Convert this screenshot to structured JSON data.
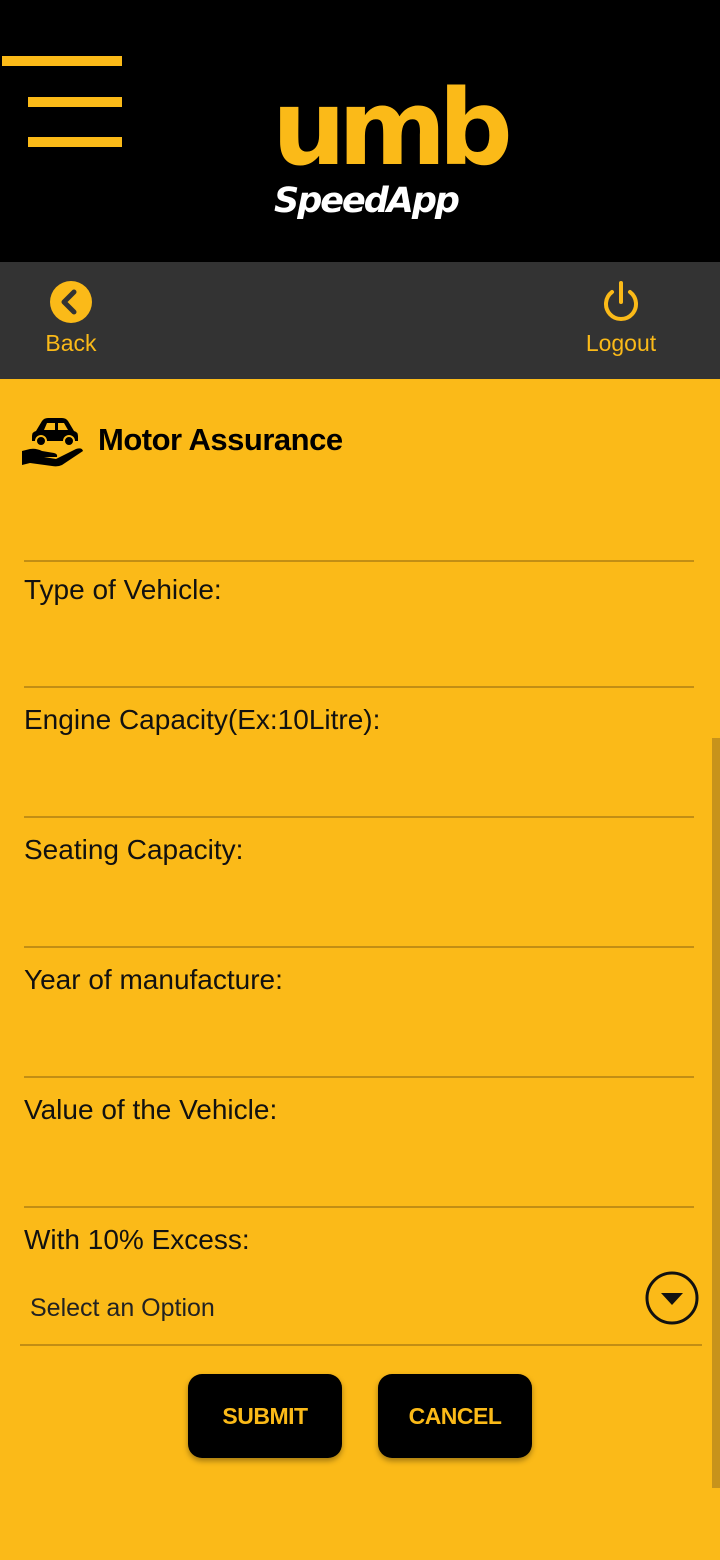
{
  "header": {
    "logo_main": "umb",
    "logo_sub": "SpeedApp",
    "menu_icon": "hamburger-menu-icon"
  },
  "nav": {
    "back_label": "Back",
    "back_icon": "chevron-left-circle-icon",
    "logout_label": "Logout",
    "logout_icon": "power-icon"
  },
  "section": {
    "icon": "car-in-hand-icon",
    "title": "Motor Assurance"
  },
  "form": {
    "fields": [
      {
        "label": "Type of Vehicle:",
        "value": ""
      },
      {
        "label": "Engine Capacity(Ex:10Litre):",
        "value": ""
      },
      {
        "label": "Seating Capacity:",
        "value": ""
      },
      {
        "label": "Year of manufacture:",
        "value": ""
      },
      {
        "label": "Value of the Vehicle:",
        "value": ""
      }
    ],
    "excess": {
      "label": "With 10% Excess:",
      "selected": "Select an Option",
      "icon": "dropdown-circle-icon"
    },
    "submit_label": "SUBMIT",
    "cancel_label": "CANCEL"
  },
  "colors": {
    "accent": "#FBBA18",
    "header_bg": "#000000",
    "navbar_bg": "#333333"
  }
}
